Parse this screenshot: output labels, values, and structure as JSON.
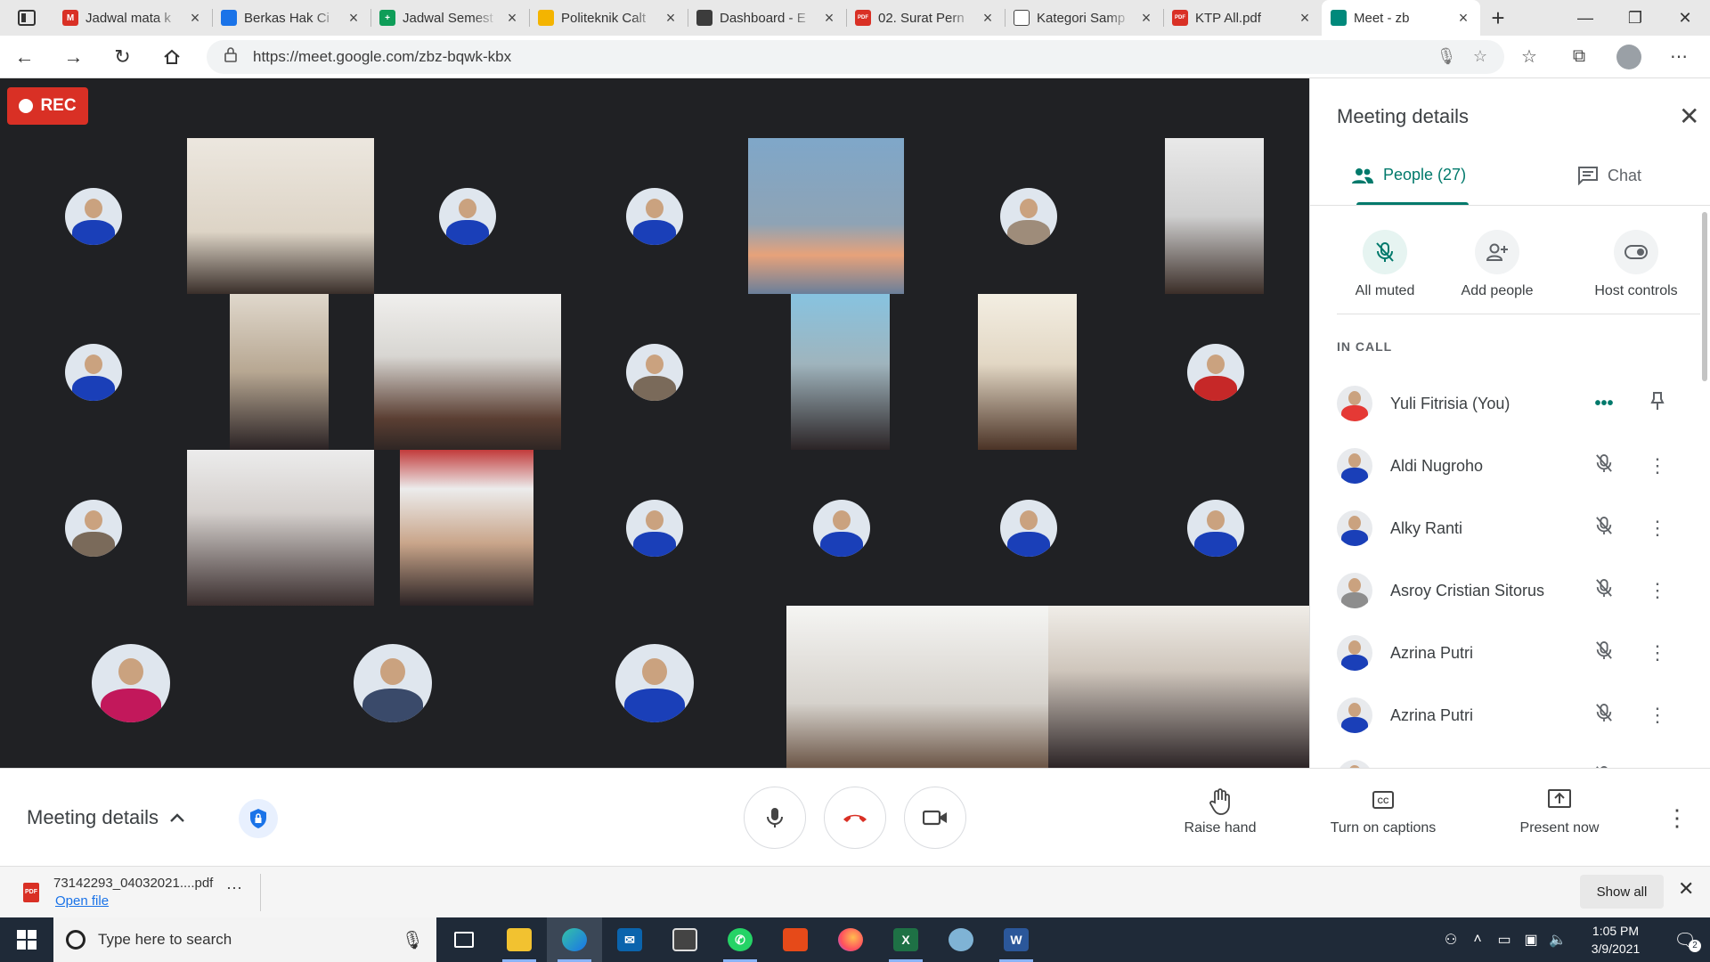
{
  "browser": {
    "tabs": [
      {
        "title": "Jadwal mata k",
        "favicon": "gmail-icon",
        "color": "#d93025",
        "glyph": "M"
      },
      {
        "title": "Berkas Hak Ci",
        "favicon": "drive-icon",
        "color": "#1a73e8",
        "glyph": ""
      },
      {
        "title": "Jadwal Semest",
        "favicon": "sheets-icon",
        "color": "#0f9d58",
        "glyph": "+"
      },
      {
        "title": "Politeknik Calt",
        "favicon": "site-icon",
        "color": "#f4b400",
        "glyph": ""
      },
      {
        "title": "Dashboard - E",
        "favicon": "dashboard-icon",
        "color": "#3c3c3c",
        "glyph": ""
      },
      {
        "title": "02. Surat Pern",
        "favicon": "pdf-icon",
        "color": "#d93025",
        "glyph": "PDF"
      },
      {
        "title": "Kategori Samp",
        "favicon": "document-icon",
        "color": "#ffffff",
        "glyph": ""
      },
      {
        "title": "KTP All.pdf",
        "favicon": "pdf-icon",
        "color": "#d93025",
        "glyph": "PDF"
      },
      {
        "title": "Meet - zb",
        "favicon": "meet-icon",
        "color": "#00897b",
        "glyph": ""
      }
    ],
    "url": "https://meet.google.com/zbz-bqwk-kbx"
  },
  "meeting": {
    "rec_label": "REC",
    "panel": {
      "title": "Meeting details",
      "tab_people": "People (27)",
      "tab_chat": "Chat",
      "actions": [
        "All muted",
        "Add people",
        "Host controls"
      ],
      "in_call_label": "IN CALL",
      "participants": [
        {
          "name": "Yuli Fitrisia (You)",
          "avatar_color": "#e53935"
        },
        {
          "name": "Aldi Nugroho",
          "avatar_color": "#1a3fb8"
        },
        {
          "name": "Alky Ranti",
          "avatar_color": "#1a3fb8"
        },
        {
          "name": "Asroy Cristian Sitorus",
          "avatar_color": "#8d8d8d"
        },
        {
          "name": "Azrina Putri",
          "avatar_color": "#1a3fb8"
        },
        {
          "name": "Azrina Putri",
          "avatar_color": "#1a3fb8"
        },
        {
          "name": "",
          "avatar_color": "#8d8d8d"
        }
      ]
    },
    "bottom": {
      "details_label": "Meeting details",
      "raise_hand": "Raise hand",
      "captions": "Turn on captions",
      "present": "Present now"
    }
  },
  "download": {
    "filename": "73142293_04032021....pdf",
    "open_label": "Open file",
    "show_all": "Show all"
  },
  "taskbar": {
    "search_placeholder": "Type here to search",
    "time": "1:05 PM",
    "date": "3/9/2021"
  }
}
